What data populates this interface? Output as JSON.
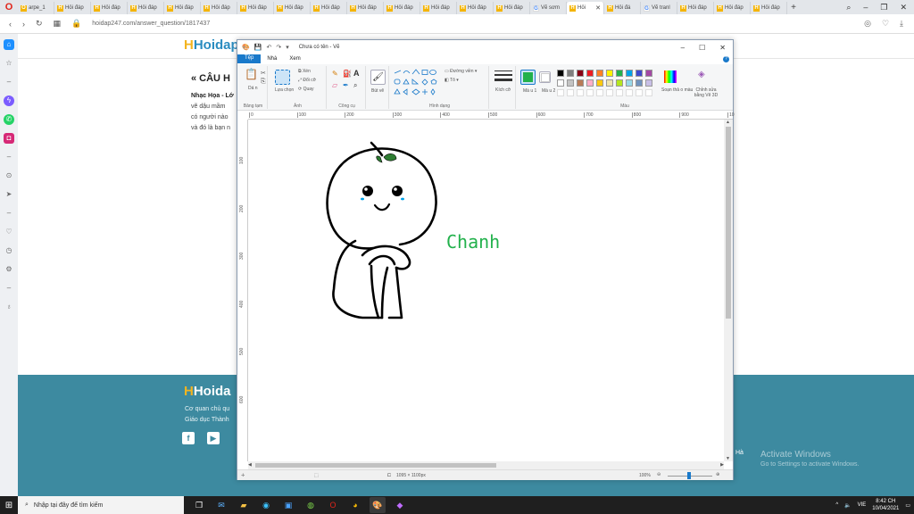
{
  "browser": {
    "tabs": [
      {
        "label": "arpe_1",
        "icon": "O"
      },
      {
        "label": "Hỏi đáp",
        "icon": "H"
      },
      {
        "label": "Hỏi đáp",
        "icon": "H"
      },
      {
        "label": "Hỏi đáp",
        "icon": "H"
      },
      {
        "label": "Hỏi đáp",
        "icon": "H"
      },
      {
        "label": "Hỏi đáp",
        "icon": "H"
      },
      {
        "label": "Hỏi đáp",
        "icon": "H"
      },
      {
        "label": "Hỏi đáp",
        "icon": "H"
      },
      {
        "label": "Hỏi đáp",
        "icon": "H"
      },
      {
        "label": "Hỏi đáp",
        "icon": "H"
      },
      {
        "label": "Hỏi đáp",
        "icon": "H"
      },
      {
        "label": "Hỏi đáp",
        "icon": "H"
      },
      {
        "label": "Hỏi đáp",
        "icon": "H"
      },
      {
        "label": "Hỏi đáp",
        "icon": "H"
      },
      {
        "label": "Vẽ sơm",
        "icon": "G"
      },
      {
        "label": "Hỏi",
        "icon": "H",
        "active": true
      },
      {
        "label": "Hỏi đá",
        "icon": "H"
      },
      {
        "label": "Vẽ tranl",
        "icon": "G"
      },
      {
        "label": "Hỏi đáp",
        "icon": "H"
      },
      {
        "label": "Hỏi đáp",
        "icon": "H"
      },
      {
        "label": "Hỏi đáp",
        "icon": "H"
      }
    ],
    "url": "hoidap247.com/answer_question/1817437"
  },
  "site": {
    "logo_main": "Hoidap",
    "question_title": "« CÂU H",
    "question_lead": "Nhạc Họa - Lớ",
    "question_lines": [
      "vẽ dậu mầm",
      "có người nào",
      "và đó là bạn n"
    ],
    "footer_logo": "Hoida",
    "footer_lines": [
      "Cơ quan chủ qu",
      "Giáo dục Thành"
    ],
    "footer_ha": "Hà",
    "activate_title": "Activate Windows",
    "activate_sub": "Go to Settings to activate Windows."
  },
  "paint": {
    "title": "Chưa có tên - Vẽ",
    "menu": [
      "Tệp",
      "Nhà",
      "Xem"
    ],
    "groups": {
      "clipboard": "Bảng tạm",
      "image": "Ảnh",
      "tools": "Công cụ",
      "shapes": "Hình dạng",
      "colors": "Màu"
    },
    "buttons": {
      "paste": "Dá n",
      "select": "Lựa chọn",
      "crop": "Xén",
      "resize": "Đổi cỡ",
      "rotate": "Quay",
      "brushes": "Bút vẽ",
      "outline": "Đường viền",
      "fill": "Tô",
      "size": "Kích cỡ",
      "color1": "Mà u 1",
      "color2": "Mà u 2",
      "edit_colors": "Soạn thả o màu",
      "paint3d": "Chỉnh sửa bằng Vẽ 3D"
    },
    "palette": [
      "#000000",
      "#7f7f7f",
      "#880015",
      "#ed1c24",
      "#ff7f27",
      "#fff200",
      "#22b14c",
      "#00a2e8",
      "#3f48cc",
      "#a349a4",
      "#ffffff",
      "#c3c3c3",
      "#b97a57",
      "#ffaec9",
      "#ffc90e",
      "#efe4b0",
      "#b5e61d",
      "#99d9ea",
      "#7092be",
      "#c8bfe7"
    ],
    "primary_color": "#22b14c",
    "secondary_color": "#ffffff",
    "ruler_top": [
      "0",
      "100",
      "200",
      "300",
      "400",
      "500",
      "600",
      "700",
      "800",
      "900",
      "10"
    ],
    "ruler_left": [
      "100",
      "200",
      "300",
      "400",
      "500",
      "600"
    ],
    "drawing_text": "Chanh",
    "status_dimensions": "1095 × 1100px",
    "zoom": "100%"
  },
  "taskbar": {
    "search_placeholder": "Nhập tại đây để tìm kiếm",
    "lang": "VIE",
    "time": "8:42 CH",
    "date": "10/04/2021"
  }
}
